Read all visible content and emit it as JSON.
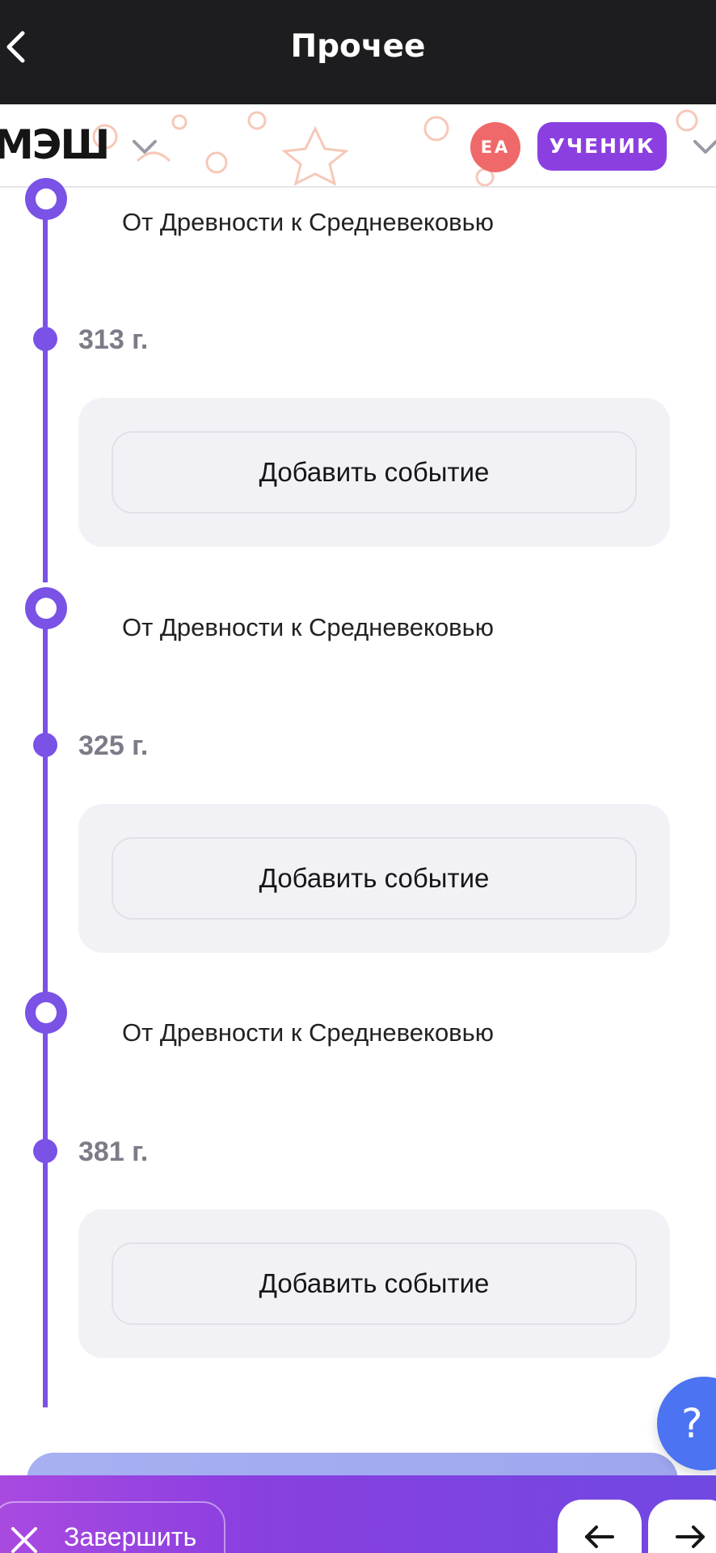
{
  "titlebar": {
    "title": "Прочее"
  },
  "header": {
    "logo": "МЭШ",
    "avatar_initials": "ЕА",
    "role": "УЧЕНИК"
  },
  "timeline": [
    {
      "era": "От Древности к Средневековью",
      "year": "313 г.",
      "action": "Добавить событие"
    },
    {
      "era": "От Древности к Средневековью",
      "year": "325 г.",
      "action": "Добавить событие"
    },
    {
      "era": "От Древности к Средневековью",
      "year": "381 г.",
      "action": "Добавить событие"
    }
  ],
  "help": {
    "label": "?"
  },
  "bottom": {
    "finish_label": "Завершить"
  },
  "colors": {
    "accent": "#7a52e6",
    "role_badge": "#8c3fe0",
    "avatar": "#f0696a",
    "help": "#4b73f2",
    "titlebar": "#1d1d1f"
  }
}
